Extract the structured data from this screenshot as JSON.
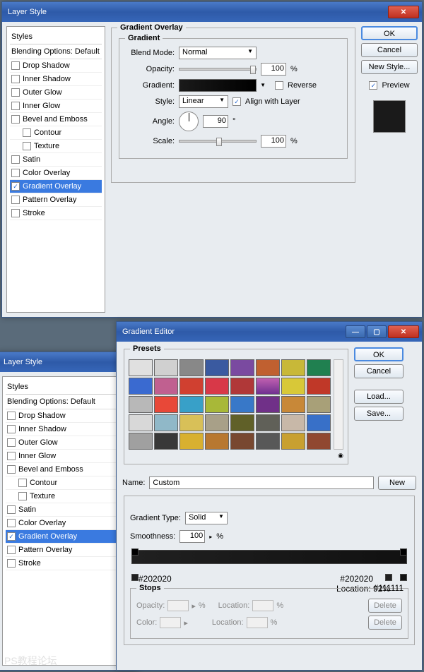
{
  "win1": {
    "title": "Layer Style",
    "styles_header": "Styles",
    "blend_opt": "Blending Options: Default",
    "items": [
      {
        "label": "Drop Shadow",
        "c": false
      },
      {
        "label": "Inner Shadow",
        "c": false
      },
      {
        "label": "Outer Glow",
        "c": false
      },
      {
        "label": "Inner Glow",
        "c": false
      },
      {
        "label": "Bevel and Emboss",
        "c": false
      },
      {
        "label": "Contour",
        "c": false,
        "sub": true
      },
      {
        "label": "Texture",
        "c": false,
        "sub": true
      },
      {
        "label": "Satin",
        "c": false
      },
      {
        "label": "Color Overlay",
        "c": false
      },
      {
        "label": "Gradient Overlay",
        "c": true,
        "sel": true
      },
      {
        "label": "Pattern Overlay",
        "c": false
      },
      {
        "label": "Stroke",
        "c": false
      }
    ],
    "sect_title": "Gradient Overlay",
    "sub_title": "Gradient",
    "blend_lbl": "Blend Mode:",
    "blend_val": "Normal",
    "opac_lbl": "Opacity:",
    "opac_val": "100",
    "pct": "%",
    "grad_lbl": "Gradient:",
    "reverse_lbl": "Reverse",
    "style_lbl": "Style:",
    "style_val": "Linear",
    "align_lbl": "Align with Layer",
    "angle_lbl": "Angle:",
    "angle_val": "90",
    "deg": "°",
    "scale_lbl": "Scale:",
    "scale_val": "100",
    "ok": "OK",
    "cancel": "Cancel",
    "newstyle": "New Style...",
    "preview": "Preview"
  },
  "win2": {
    "title": "Layer Style",
    "styles_header": "Styles",
    "blend_opt": "Blending Options: Default"
  },
  "gradEd": {
    "title": "Gradient Editor",
    "presets_lbl": "Presets",
    "ok": "OK",
    "cancel": "Cancel",
    "load": "Load...",
    "save": "Save...",
    "name_lbl": "Name:",
    "name_val": "Custom",
    "new": "New",
    "type_lbl": "Gradient Type:",
    "type_val": "Solid",
    "smooth_lbl": "Smoothness:",
    "smooth_val": "100",
    "pct": "%",
    "stop1": "#202020",
    "stop2": "#202020",
    "loc_lbl": "Location: 92%",
    "stop3": "#111111",
    "stops_lbl": "Stops",
    "opac_lbl": "Opacity:",
    "loc2_lbl": "Location:",
    "delete": "Delete",
    "color_lbl": "Color:"
  },
  "preset_colors": [
    "#e0e0e0",
    "#d0d0d0",
    "#888",
    "#3a5aa0",
    "#7a4aa0",
    "#c06030",
    "#c8b838",
    "#208050",
    "#3a6ad0",
    "#c06090",
    "#d04030",
    "#d83848",
    "#b03838",
    "linear-gradient(#c060b0,#703090)",
    "#d8c838",
    "#c03828",
    "#b8b8b8",
    "#e84838",
    "#38a0c8",
    "#a8b838",
    "#3878c8",
    "#703088",
    "#c88838",
    "#a8a078",
    "#d8d8d8",
    "#90b8c8",
    "#d8c058",
    "#a8a088",
    "#606028",
    "#606058",
    "#c8b8a8",
    "#3870c8",
    "#a0a0a0",
    "#383838",
    "#d8b030",
    "#b87830",
    "#784830",
    "#585858",
    "#c8a030",
    "#904830"
  ],
  "watermark": "PS教程论坛"
}
